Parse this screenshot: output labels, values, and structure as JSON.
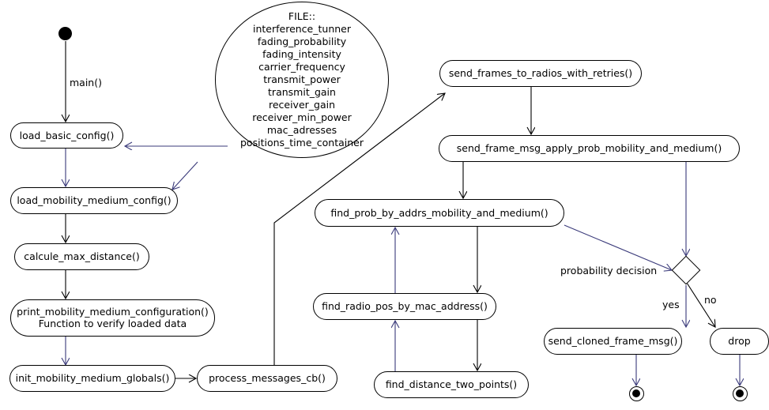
{
  "diagram": {
    "title": "UML activity diagram",
    "colors": {
      "stroke_black": "#000000",
      "stroke_navy": "#3a3a7a",
      "background": "#ffffff"
    },
    "start_node": {
      "name": "start"
    },
    "end_nodes": [
      {
        "name": "final-send-cloned"
      },
      {
        "name": "final-drop"
      }
    ],
    "note": {
      "header": "FILE::",
      "lines": [
        "interference_tunner",
        "fading_probability",
        "fading_intensity",
        "carrier_frequency",
        "transmit_power",
        "transmit_gain",
        "receiver_gain",
        "receiver_min_power",
        "mac_adresses",
        "positions_time_container"
      ],
      "text": "FILE::\ninterference_tunner\nfading_probability\nfading_intensity\ncarrier_frequency\ntransmit_power\ntransmit_gain\nreceiver_gain\nreceiver_min_power\nmac_adresses\npositions_time_container"
    },
    "nodes": [
      {
        "id": "load_basic_config",
        "label": "load_basic_config()"
      },
      {
        "id": "load_mobility_medium",
        "label": "load_mobility_medium_config()"
      },
      {
        "id": "calcule_max_distance",
        "label": "calcule_max_distance()"
      },
      {
        "id": "print_mobility",
        "label": "print_mobility_medium_configuration()\nFunction to verify loaded data"
      },
      {
        "id": "init_globals",
        "label": "init_mobility_medium_globals()"
      },
      {
        "id": "process_messages_cb",
        "label": "process_messages_cb()"
      },
      {
        "id": "send_frames_retries",
        "label": "send_frames_to_radios_with_retries()"
      },
      {
        "id": "send_frame_msg",
        "label": "send_frame_msg_apply_prob_mobility_and_medium()"
      },
      {
        "id": "find_prob",
        "label": "find_prob_by_addrs_mobility_and_medium()"
      },
      {
        "id": "find_radio_pos",
        "label": "find_radio_pos_by_mac_address()"
      },
      {
        "id": "find_distance",
        "label": "find_distance_two_points()"
      },
      {
        "id": "send_cloned_frame_msg",
        "label": "send_cloned_frame_msg()"
      },
      {
        "id": "drop",
        "label": "drop"
      }
    ],
    "edge_labels": {
      "main": "main()",
      "probability_decision": "probability decision",
      "yes": "yes",
      "no": "no"
    }
  }
}
